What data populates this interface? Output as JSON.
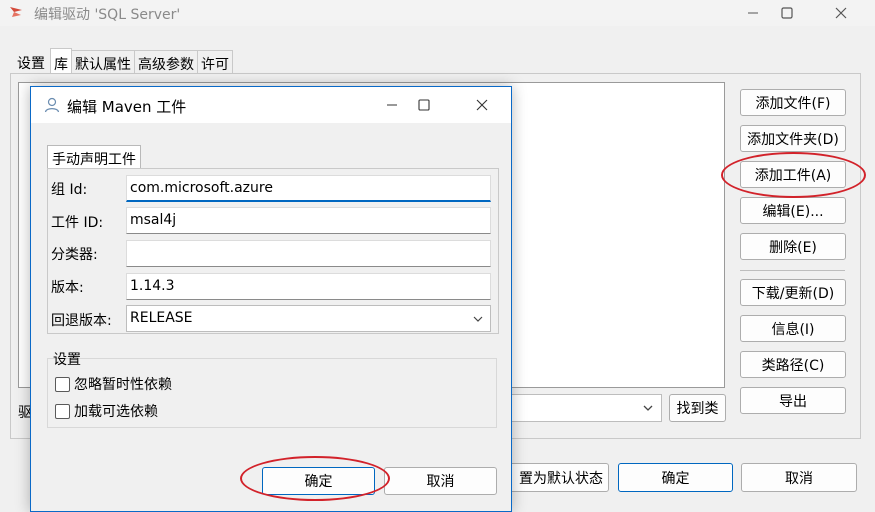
{
  "window": {
    "title": "编辑驱动 'SQL Server'",
    "tabs": [
      "设置",
      "库",
      "默认属性",
      "高级参数",
      "许可"
    ],
    "active_tab": "库"
  },
  "side_buttons": {
    "add_file": "添加文件(F)",
    "add_folder": "添加文件夹(D)",
    "add_artifact": "添加工件(A)",
    "edit": "编辑(E)...",
    "delete": "删除(E)",
    "download": "下载/更新(D)",
    "info": "信息(I)",
    "classpath": "类路径(C)",
    "export": "导出"
  },
  "driver": {
    "label": "驱",
    "find_class": "找到类"
  },
  "bottom_buttons": {
    "reset_default": "置为默认状态",
    "ok": "确定",
    "cancel": "取消"
  },
  "dialog": {
    "title": "编辑 Maven 工件",
    "tab": "手动声明工件",
    "fields": {
      "group_id": {
        "label": "组 Id:",
        "value": "com.microsoft.azure"
      },
      "artifact_id": {
        "label": "工件 ID:",
        "value": "msal4j"
      },
      "classifier": {
        "label": "分类器:",
        "value": ""
      },
      "version": {
        "label": "版本:",
        "value": "1.14.3"
      },
      "fallback_version": {
        "label": "回退版本:",
        "value": "RELEASE"
      }
    },
    "settings": {
      "group_label": "设置",
      "ignore_transitive": "忽略暂时性依赖",
      "load_optional": "加载可选依赖"
    },
    "ok": "确定",
    "cancel": "取消"
  },
  "colors": {
    "accent": "#0067c0",
    "dialog_border": "#0a69c7",
    "annotation_red": "#d2222a"
  }
}
